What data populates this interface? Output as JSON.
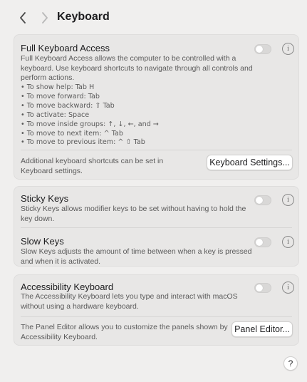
{
  "toolbar": {
    "back_icon": "chevron-left-icon",
    "back_glyph": "〈",
    "forward_icon": "chevron-right-icon",
    "forward_glyph": "〉",
    "title": "Keyboard"
  },
  "full_keyboard_access": {
    "title": "Full Keyboard Access",
    "description": "Full Keyboard Access allows the computer to be controlled with a keyboard. Use keyboard shortcuts to navigate through all controls and perform actions.",
    "enabled": false,
    "shortcuts": [
      "• To show help: Tab H",
      "• To move forward: Tab",
      "• To move backward: ⇧ Tab",
      "• To activate: Space",
      "• To move inside groups: ↑, ↓, ←, and →",
      "• To move to next item: ^ Tab",
      "• To move to previous item: ^ ⇧ Tab"
    ],
    "footer_text": "Additional keyboard shortcuts can be set in Keyboard settings.",
    "button_label": "Keyboard Settings..."
  },
  "sticky_keys": {
    "title": "Sticky Keys",
    "description": "Sticky Keys allows modifier keys to be set without having to hold the key down.",
    "enabled": false
  },
  "slow_keys": {
    "title": "Slow Keys",
    "description": "Slow Keys adjusts the amount of time between when a key is pressed and when it is activated.",
    "enabled": false
  },
  "accessibility_keyboard": {
    "title": "Accessibility Keyboard",
    "description": "The Accessibility Keyboard lets you type and interact with macOS without using a hardware keyboard.",
    "enabled": false,
    "footer_text": "The Panel Editor allows you to customize the panels shown by Accessibility Keyboard.",
    "button_label": "Panel Editor..."
  },
  "info_glyph": "i",
  "help": {
    "icon": "question-mark-icon",
    "glyph": "?"
  },
  "colors": {
    "background": "#f0efee",
    "card": "#e8e7e6",
    "toggle_off": "#d9d8d7"
  }
}
